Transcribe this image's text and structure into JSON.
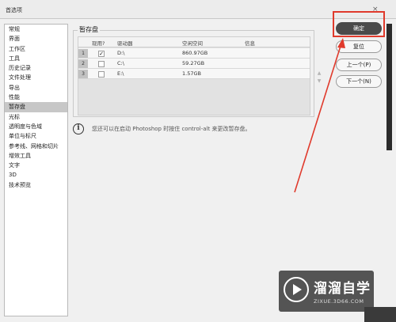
{
  "window": {
    "title": "首选项",
    "close_glyph": "×"
  },
  "sidebar": {
    "items": [
      {
        "label": "常规"
      },
      {
        "label": "界面"
      },
      {
        "label": "工作区"
      },
      {
        "label": "工具"
      },
      {
        "label": "历史记录"
      },
      {
        "label": "文件处理"
      },
      {
        "label": "导出"
      },
      {
        "label": "性能"
      },
      {
        "label": "暂存盘"
      },
      {
        "label": "光标"
      },
      {
        "label": "透明度与色域"
      },
      {
        "label": "单位与标尺"
      },
      {
        "label": "参考线、网格和切片"
      },
      {
        "label": "增效工具"
      },
      {
        "label": "文字"
      },
      {
        "label": "3D"
      },
      {
        "label": "技术预览"
      }
    ],
    "selected_index": 8
  },
  "scratch": {
    "group_title": "暂存盘",
    "columns": {
      "active": "现用?",
      "drive": "驱动器",
      "space": "空闲空间",
      "info": "信息"
    },
    "rows": [
      {
        "num": "1",
        "checked": true,
        "drive": "D:\\",
        "space": "860.97GB",
        "info": ""
      },
      {
        "num": "2",
        "checked": false,
        "drive": "C:\\",
        "space": "59.27GB",
        "info": ""
      },
      {
        "num": "3",
        "checked": false,
        "drive": "E:\\",
        "space": "1.57GB",
        "info": ""
      }
    ],
    "move_up_glyph": "▲",
    "move_down_glyph": "▼"
  },
  "info": {
    "icon": "info-icon",
    "glyph": "i",
    "text": "您还可以在启动 Photoshop 时按住 control-alt 来更改暂存盘。"
  },
  "buttons": {
    "ok": "确定",
    "reset": "复位",
    "prev": "上一个(P)",
    "next": "下一个(N)"
  },
  "colors": {
    "highlight_red": "#e03a2c",
    "primary_button": "#4a4a4a"
  },
  "watermark": {
    "name": "溜溜自学",
    "url": "ZIXUE.3D66.COM"
  }
}
